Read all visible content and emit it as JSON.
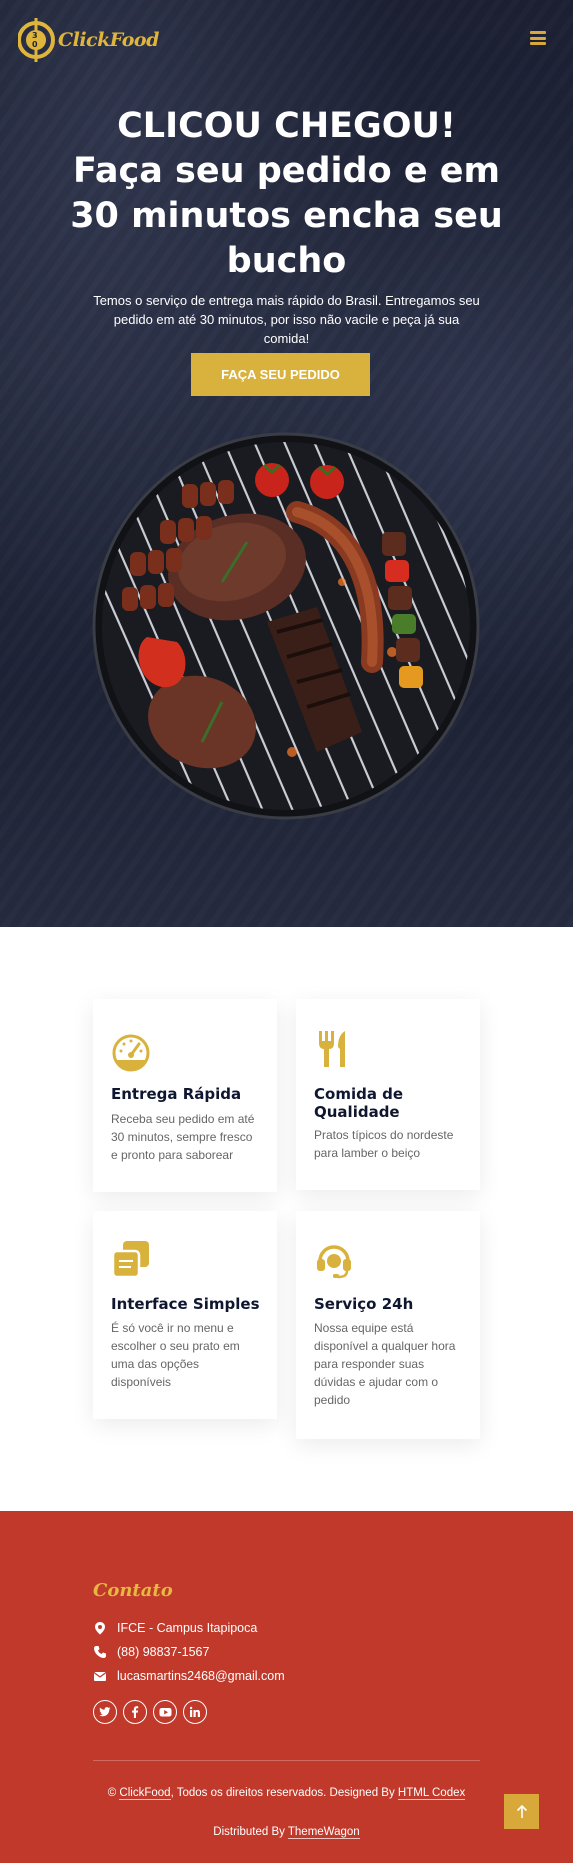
{
  "header": {
    "logo_text": "ClickFood",
    "menu_icon": "hamburger-menu-icon"
  },
  "hero": {
    "title_line1": "CLICOU CHEGOU!",
    "title_rest": "Faça seu pedido e em 30 minutos encha seu bucho",
    "subtitle": "Temos o serviço de entrega mais rápido do Brasil. Entregamos seu pedido em até 30 minutos, por isso não vacile e peça já sua comida!",
    "cta_label": "FAÇA SEU PEDIDO",
    "image": "grilled-meat-barbecue"
  },
  "features": [
    {
      "icon": "speedometer-icon",
      "title": "Entrega Rápida",
      "text": "Receba seu pedido em até 30 minutos, sempre fresco e pronto para saborear"
    },
    {
      "icon": "utensils-icon",
      "title": "Comida de Qualidade",
      "text": "Pratos típicos do nordeste para lamber o beiço"
    },
    {
      "icon": "copy-icon",
      "title": "Interface Simples",
      "text": "É só você ir no menu e escolher o seu prato em uma das opções disponíveis"
    },
    {
      "icon": "headset-icon",
      "title": "Serviço 24h",
      "text": "Nossa equipe está disponível a qualquer hora para responder suas dúvidas e ajudar com o pedido"
    }
  ],
  "footer": {
    "contact_title": "Contato",
    "address": "IFCE - Campus Itapipoca",
    "phone": "(88) 98837-1567",
    "email": "lucasmartins2468@gmail.com",
    "socials": [
      "twitter-icon",
      "facebook-icon",
      "youtube-icon",
      "linkedin-icon"
    ],
    "copy_prefix": "© ",
    "copy_brand": "ClickFood",
    "copy_middle": ", Todos os direitos reservados. Designed By ",
    "copy_designer": "HTML Codex",
    "dist_prefix": "Distributed By ",
    "dist_link": "ThemeWagon"
  },
  "colors": {
    "accent": "#d9b23d",
    "footer_bg": "#c0392b",
    "hero_bg": "#1f2436",
    "heading": "#0f1730"
  }
}
